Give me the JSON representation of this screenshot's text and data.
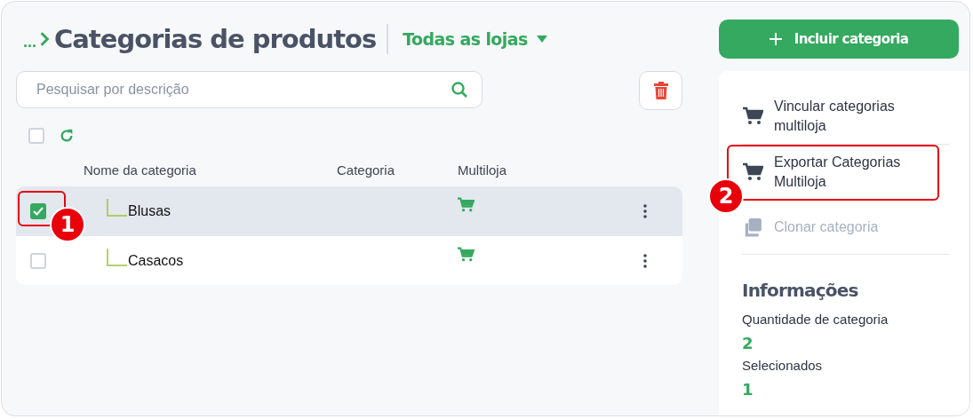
{
  "breadcrumb": {
    "ellipsis": "...",
    "title": "Categorias de produtos"
  },
  "store_filter": {
    "label": "Todas as lojas"
  },
  "search": {
    "placeholder": "Pesquisar por descrição"
  },
  "select_all": {
    "checked": false
  },
  "table": {
    "columns": [
      "Nome da categoria",
      "Categoria",
      "Multiloja"
    ],
    "rows": [
      {
        "name": "Blusas",
        "selected": true,
        "multistore": true,
        "callout": "1"
      },
      {
        "name": "Casacos",
        "selected": false,
        "multistore": true
      }
    ]
  },
  "add_button": {
    "label": "Incluir categoria"
  },
  "menu": [
    {
      "label": "Vincular categorias multiloja",
      "kind": "cart",
      "disabled": false
    },
    {
      "label": "Exportar Categorias Multiloja",
      "kind": "cart",
      "disabled": false,
      "callout": "2"
    },
    {
      "label": "Clonar categoria",
      "kind": "clone",
      "disabled": true
    }
  ],
  "info": {
    "heading": "Informações",
    "items": [
      {
        "label": "Quantidade de categoria",
        "value": "2"
      },
      {
        "label": "Selecionados",
        "value": "1"
      }
    ]
  }
}
